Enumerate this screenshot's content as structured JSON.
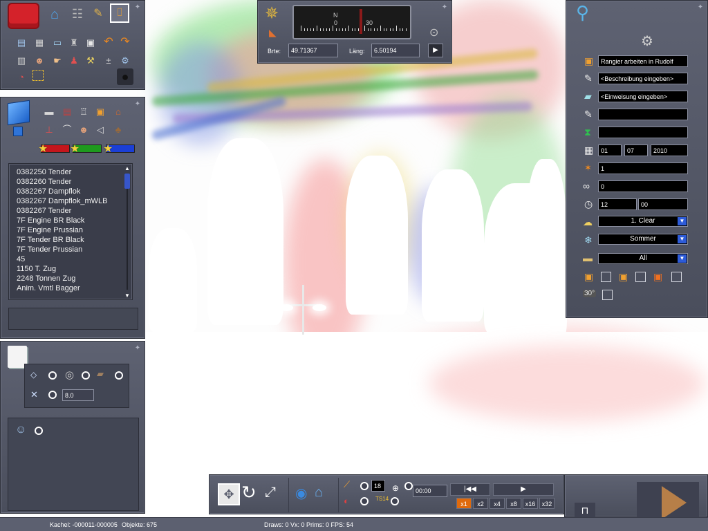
{
  "toolbox": {
    "pin_icon": "pin-icon"
  },
  "object_panel": {
    "list_items": [
      "0382250 Tender",
      "0382260 Tender",
      "0382267 Dampflok",
      "0382267 Dampflok_mWLB",
      "0382267 Tender",
      "7F Engine BR Black",
      "7F Engine Prussian",
      "7F Tender BR Black",
      "7F Tender Prussian",
      "45",
      "1150 T. Zug",
      "2248 Tonnen Zug",
      "Anim. Vmtl Bagger"
    ]
  },
  "props_panel": {
    "value_field": "8.0"
  },
  "compass": {
    "north_label": "N",
    "scale_labels": [
      "0",
      "30"
    ],
    "lat_label": "Brte:",
    "lat_value": "49.71367",
    "lon_label": "Läng:",
    "lon_value": "6.50194"
  },
  "scenario": {
    "name": "Rangier arbeiten in Rudolf",
    "description": "<Beschreibung eingeben>",
    "briefing": "<Einweisung eingeben>",
    "date_day": "01",
    "date_month": "07",
    "date_year": "2010",
    "difficulty": "1",
    "duration": "0",
    "time_hour": "12",
    "time_minute": "00",
    "weather": "1. Clear",
    "season": "Sommer",
    "filter": "All"
  },
  "bottombar": {
    "count_value": "18",
    "time_value": "00:00",
    "speeds": [
      "x1",
      "x2",
      "x4",
      "x8",
      "x16",
      "x32"
    ],
    "active_speed": "x1"
  },
  "status": {
    "tile": "Kachel: -000011-000005",
    "objects": "Objekte: 675",
    "stats": "Draws: 0 Vx: 0 Prims: 0 FPS: 54"
  },
  "colors": {
    "panel": "#555968",
    "accent_blue": "#2d5bd8",
    "active_speed": "#e06a0c",
    "bar_red": "#c4161c",
    "bar_green": "#1e9a1e",
    "bar_blue": "#1b3fd6"
  }
}
